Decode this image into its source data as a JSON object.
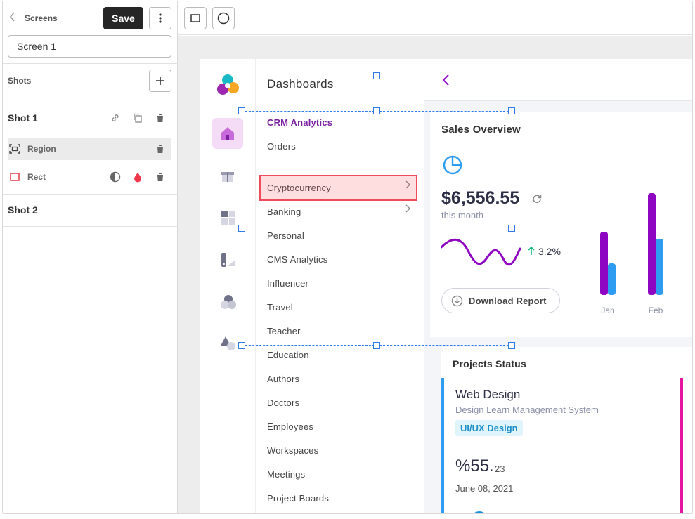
{
  "editor": {
    "screens_label": "Screens",
    "save_label": "Save",
    "screen_name": "Screen 1",
    "shots_label": "Shots",
    "shots": [
      {
        "title": "Shot 1",
        "layers": [
          {
            "label": "Region",
            "selected": true
          },
          {
            "label": "Rect",
            "selected": false
          }
        ]
      },
      {
        "title": "Shot 2",
        "layers": []
      }
    ]
  },
  "app": {
    "menu_title": "Dashboards",
    "menu_items": [
      {
        "label": "CRM Analytics",
        "active": true,
        "chevron": false
      },
      {
        "label": "Orders",
        "active": false,
        "chevron": false
      },
      {
        "label": "Cryptocurrency",
        "active": false,
        "chevron": true
      },
      {
        "label": "Banking",
        "active": false,
        "chevron": true
      },
      {
        "label": "Personal",
        "active": false,
        "chevron": false
      },
      {
        "label": "CMS Analytics",
        "active": false,
        "chevron": false
      },
      {
        "label": "Influencer",
        "active": false,
        "chevron": false
      },
      {
        "label": "Travel",
        "active": false,
        "chevron": false
      },
      {
        "label": "Teacher",
        "active": false,
        "chevron": false
      },
      {
        "label": "Education",
        "active": false,
        "chevron": false
      },
      {
        "label": "Authors",
        "active": false,
        "chevron": false
      },
      {
        "label": "Doctors",
        "active": false,
        "chevron": false
      },
      {
        "label": "Employees",
        "active": false,
        "chevron": false
      },
      {
        "label": "Workspaces",
        "active": false,
        "chevron": false
      },
      {
        "label": "Meetings",
        "active": false,
        "chevron": false
      },
      {
        "label": "Project Boards",
        "active": false,
        "chevron": false
      }
    ],
    "sales": {
      "title": "Sales Overview",
      "amount": "$6,556.55",
      "period": "this month",
      "change": "3.2%",
      "download_label": "Download Report"
    },
    "chart_data": {
      "type": "bar",
      "categories": [
        "Jan",
        "Feb"
      ],
      "series": [
        {
          "values": [
            90,
            145
          ],
          "color": "#8e05c2"
        },
        {
          "values": [
            45,
            80
          ],
          "color": "#2e9cf0"
        }
      ],
      "ylim": [
        0,
        150
      ]
    },
    "projects": {
      "title": "Projects Status",
      "project_name": "Web Design",
      "project_sub": "Design Learn Management System",
      "tag": "UI/UX Design",
      "percent_main": "%55.",
      "percent_decimal": "23",
      "date": "June 08, 2021"
    }
  },
  "colors": {
    "accent_purple": "#7b1fa2",
    "selection_blue": "#2e7bea",
    "highlight_red": "#ef4b5c"
  }
}
